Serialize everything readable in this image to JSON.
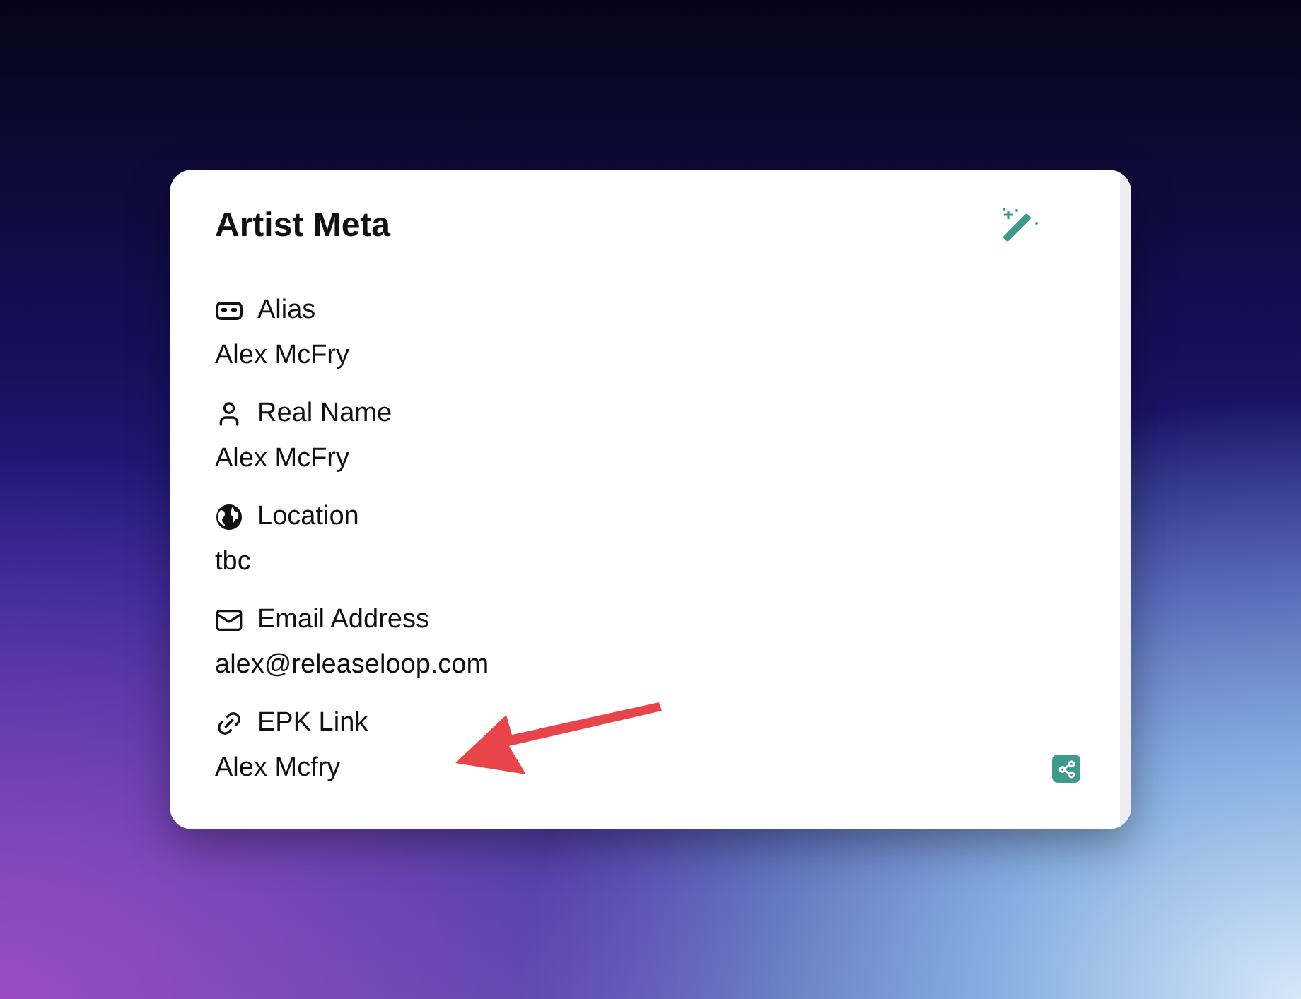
{
  "card": {
    "title": "Artist Meta",
    "fields": [
      {
        "kind": "mask",
        "label": "Alias",
        "value": "Alex McFry"
      },
      {
        "kind": "user",
        "label": "Real Name",
        "value": "Alex McFry"
      },
      {
        "kind": "globe",
        "label": "Location",
        "value": "tbc"
      },
      {
        "kind": "mail",
        "label": "Email Address",
        "value": "alex@releaseloop.com"
      },
      {
        "kind": "link",
        "label": "EPK Link",
        "value": "Alex Mcfry",
        "shareable": true
      }
    ]
  }
}
